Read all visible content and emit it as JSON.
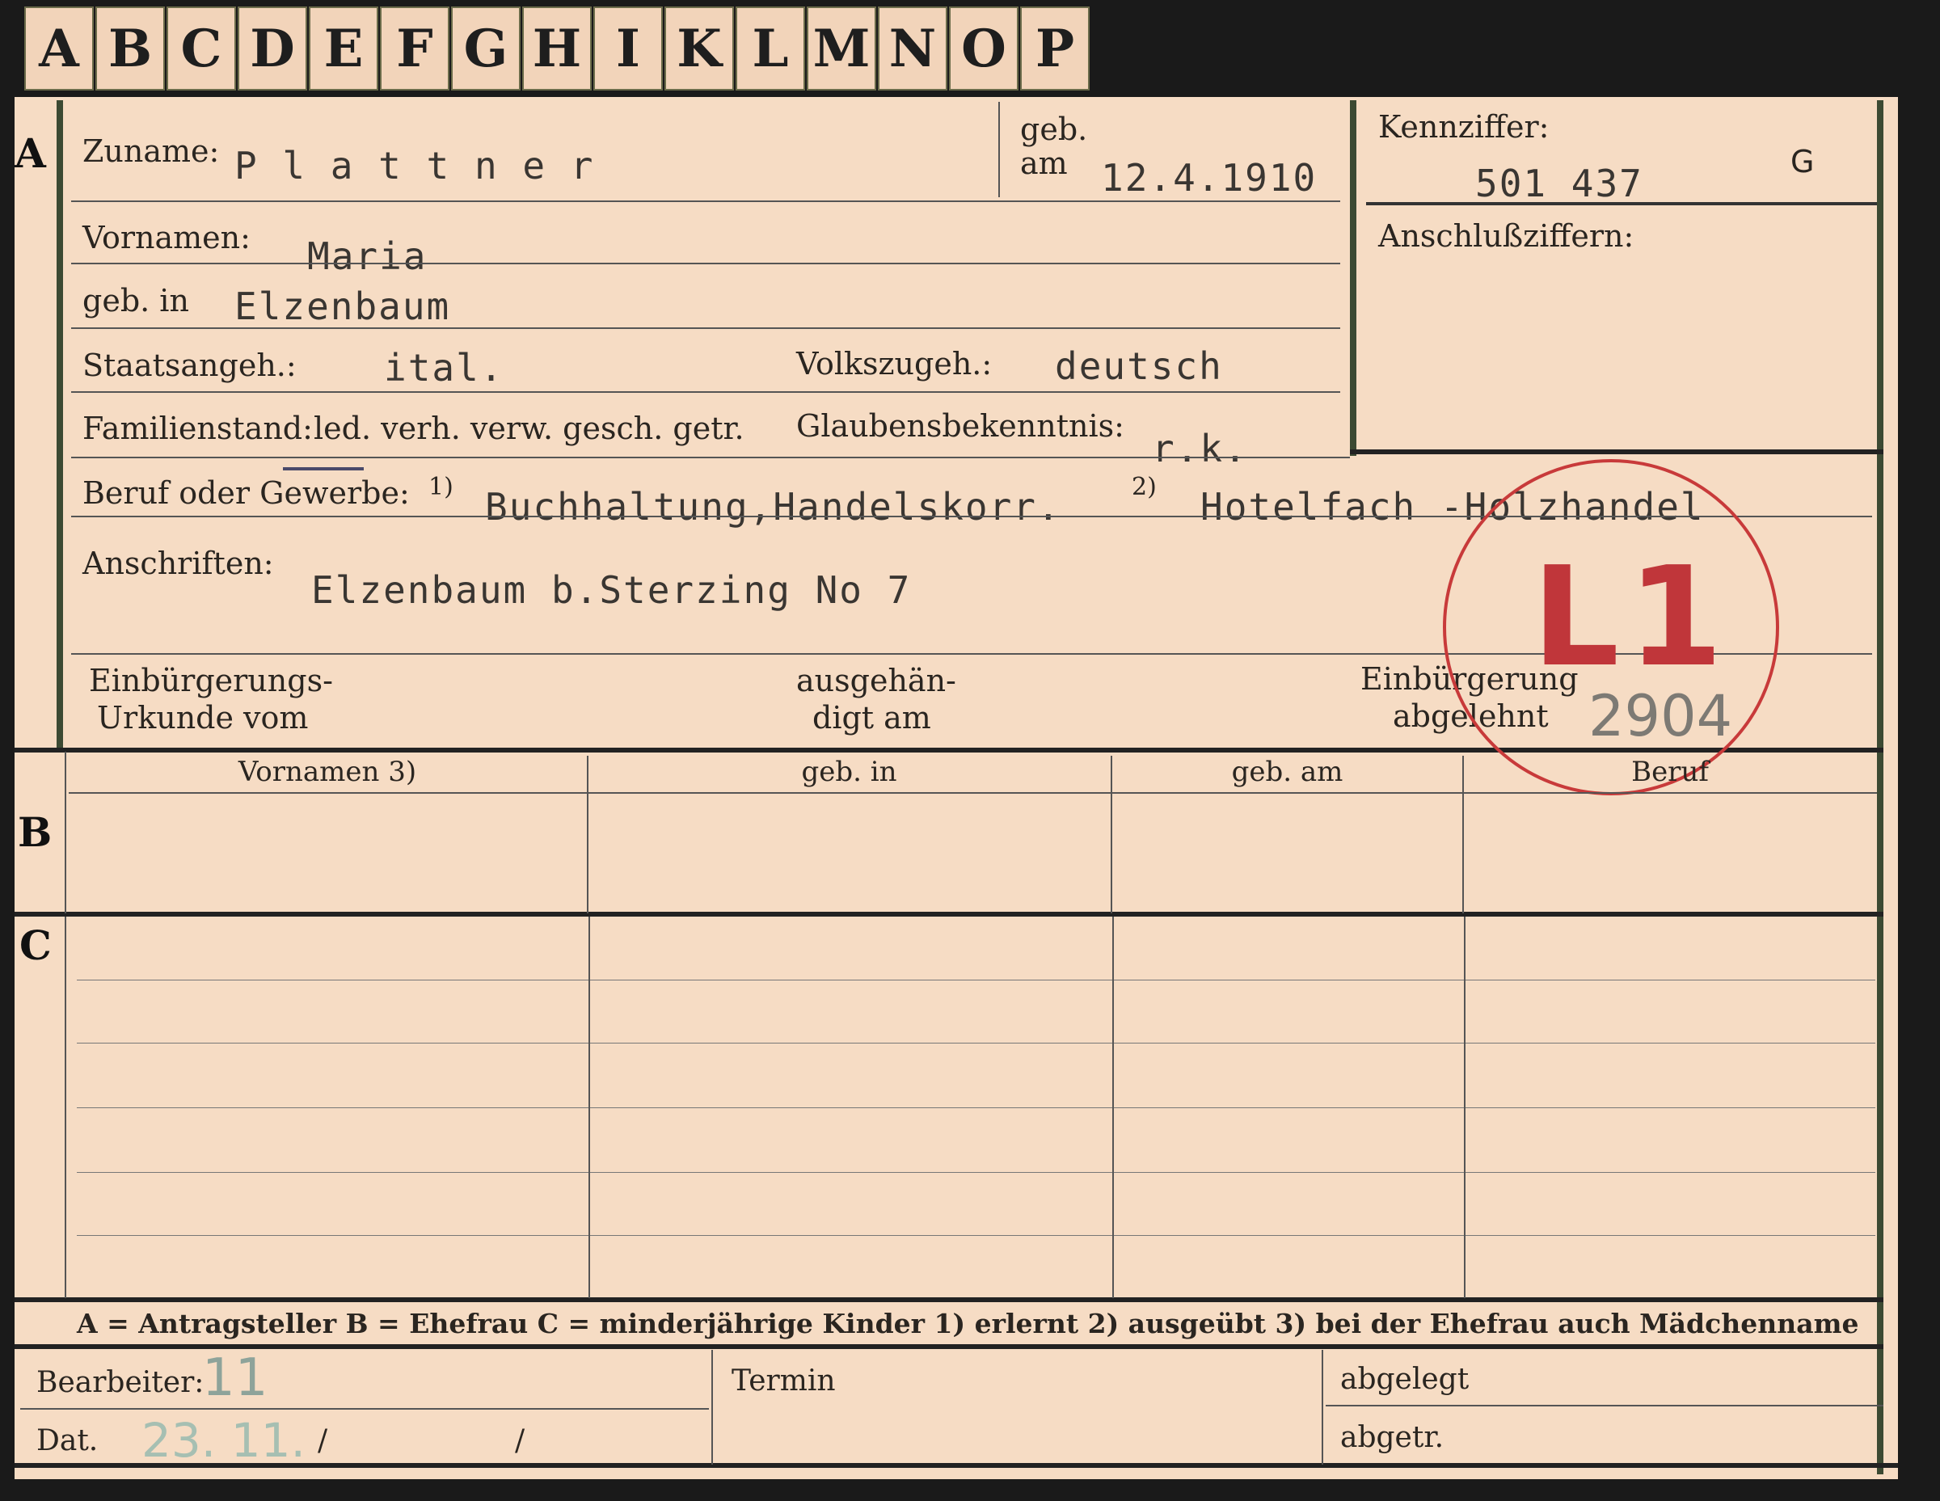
{
  "tabs": [
    "A",
    "B",
    "C",
    "D",
    "E",
    "F",
    "G",
    "H",
    "I",
    "K",
    "L",
    "M",
    "N",
    "O",
    "P"
  ],
  "sections": {
    "a": "A",
    "b": "B",
    "c": "C"
  },
  "fields": {
    "zuname_label": "Zuname:",
    "zuname_value": "P l a t t n e r",
    "geb_label_1": "geb.",
    "geb_label_2": "am",
    "geb_value": "12.4.1910",
    "kennziffer_label": "Kennziffer:",
    "kennziffer_value": "501 437",
    "kennziffer_suffix": "G",
    "anschluss_label": "Anschlußziffern:",
    "vornamen_label": "Vornamen:",
    "vornamen_value": "Maria",
    "gebin_label": "geb. in",
    "gebin_value": "Elzenbaum",
    "staat_label": "Staatsangeh.:",
    "staat_value": "ital.",
    "volk_label": "Volkszugeh.:",
    "volk_value": "deutsch",
    "familie_label": "Familienstand:",
    "familie_options": "led. verh. verw. gesch. getr.",
    "glauben_label": "Glaubensbekenntnis:",
    "glauben_value": "r.k.",
    "beruf_label": "Beruf oder Gewerbe:",
    "beruf_1_mark": "1)",
    "beruf_1_value": "Buchhaltung,Handelskorr.",
    "beruf_2_mark": "2)",
    "beruf_2_value": "Hotelfach -Holzhandel",
    "anschriften_label": "Anschriften:",
    "anschriften_value": "Elzenbaum b.Sterzing No 7",
    "einb_label_1": "Einbürgerungs-",
    "einb_label_2": "Urkunde vom",
    "ausg_label_1": "ausgehän-",
    "ausg_label_2": "digt am",
    "abgel_label_1": "Einbürgerung",
    "abgel_label_2": "abgelehnt"
  },
  "stamp": {
    "text": "L1",
    "number": "2904",
    "color": "#c0363a"
  },
  "table_headers": [
    "Vornamen 3)",
    "geb. in",
    "geb. am",
    "Beruf"
  ],
  "legend": "A = Antragsteller   B = Ehefrau   C = minderjährige Kinder   1) erlernt   2) ausgeübt   3) bei der Ehefrau auch Mädchenname",
  "footer": {
    "bearbeiter_label": "Bearbeiter:",
    "bearbeiter_value": "11",
    "dat_label": "Dat.",
    "dat_value": "23. 11.",
    "dat_slash_1": "/",
    "dat_slash_2": "/",
    "termin_label": "Termin",
    "abgelegt_label": "abgelegt",
    "abgetr_label": "abgetr."
  }
}
